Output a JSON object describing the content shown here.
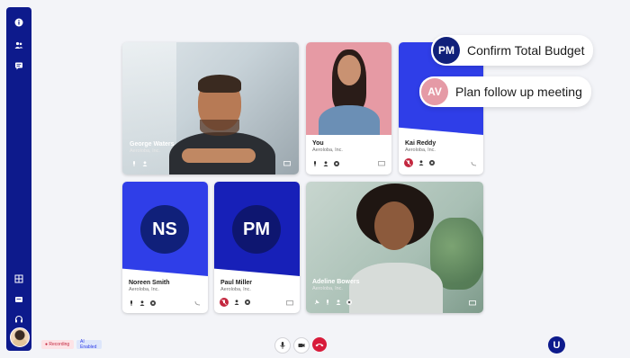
{
  "sidebar": {
    "items": [
      {
        "icon": "info-icon"
      },
      {
        "icon": "people-icon"
      },
      {
        "icon": "chat-icon"
      }
    ],
    "bottom_items": [
      {
        "icon": "grid-icon"
      },
      {
        "icon": "message-icon"
      },
      {
        "icon": "headset-icon"
      }
    ]
  },
  "participants": [
    {
      "name": "George Waters",
      "org": "Aeroloba, Inc."
    },
    {
      "name": "You",
      "org": "Aeroloba, Inc."
    },
    {
      "name": "Kai Reddy",
      "org": "Aeroloba, Inc."
    },
    {
      "name": "Noreen Smith",
      "org": "Aeroloba, Inc.",
      "initials": "NS"
    },
    {
      "name": "Paul Miller",
      "org": "Aeroloba, Inc.",
      "initials": "PM"
    },
    {
      "name": "Adeline Bowers",
      "org": "Aeroloba, Inc."
    }
  ],
  "tasks": [
    {
      "initials": "PM",
      "text": "Confirm Total Budget",
      "color": "#10207a"
    },
    {
      "initials": "AV",
      "text": "Plan follow up meeting",
      "color": "#e59aa6"
    }
  ],
  "footer": {
    "recording_label": "● Recording",
    "enabled_label": "AI Enabled",
    "logo_letter": "U"
  },
  "colors": {
    "sidebar": "#0d1a8c",
    "blue_tile": "#2f3ee8",
    "navy_tile": "#1720b8",
    "pink_tile": "#e69aa4",
    "end_call": "#d81b3a"
  }
}
